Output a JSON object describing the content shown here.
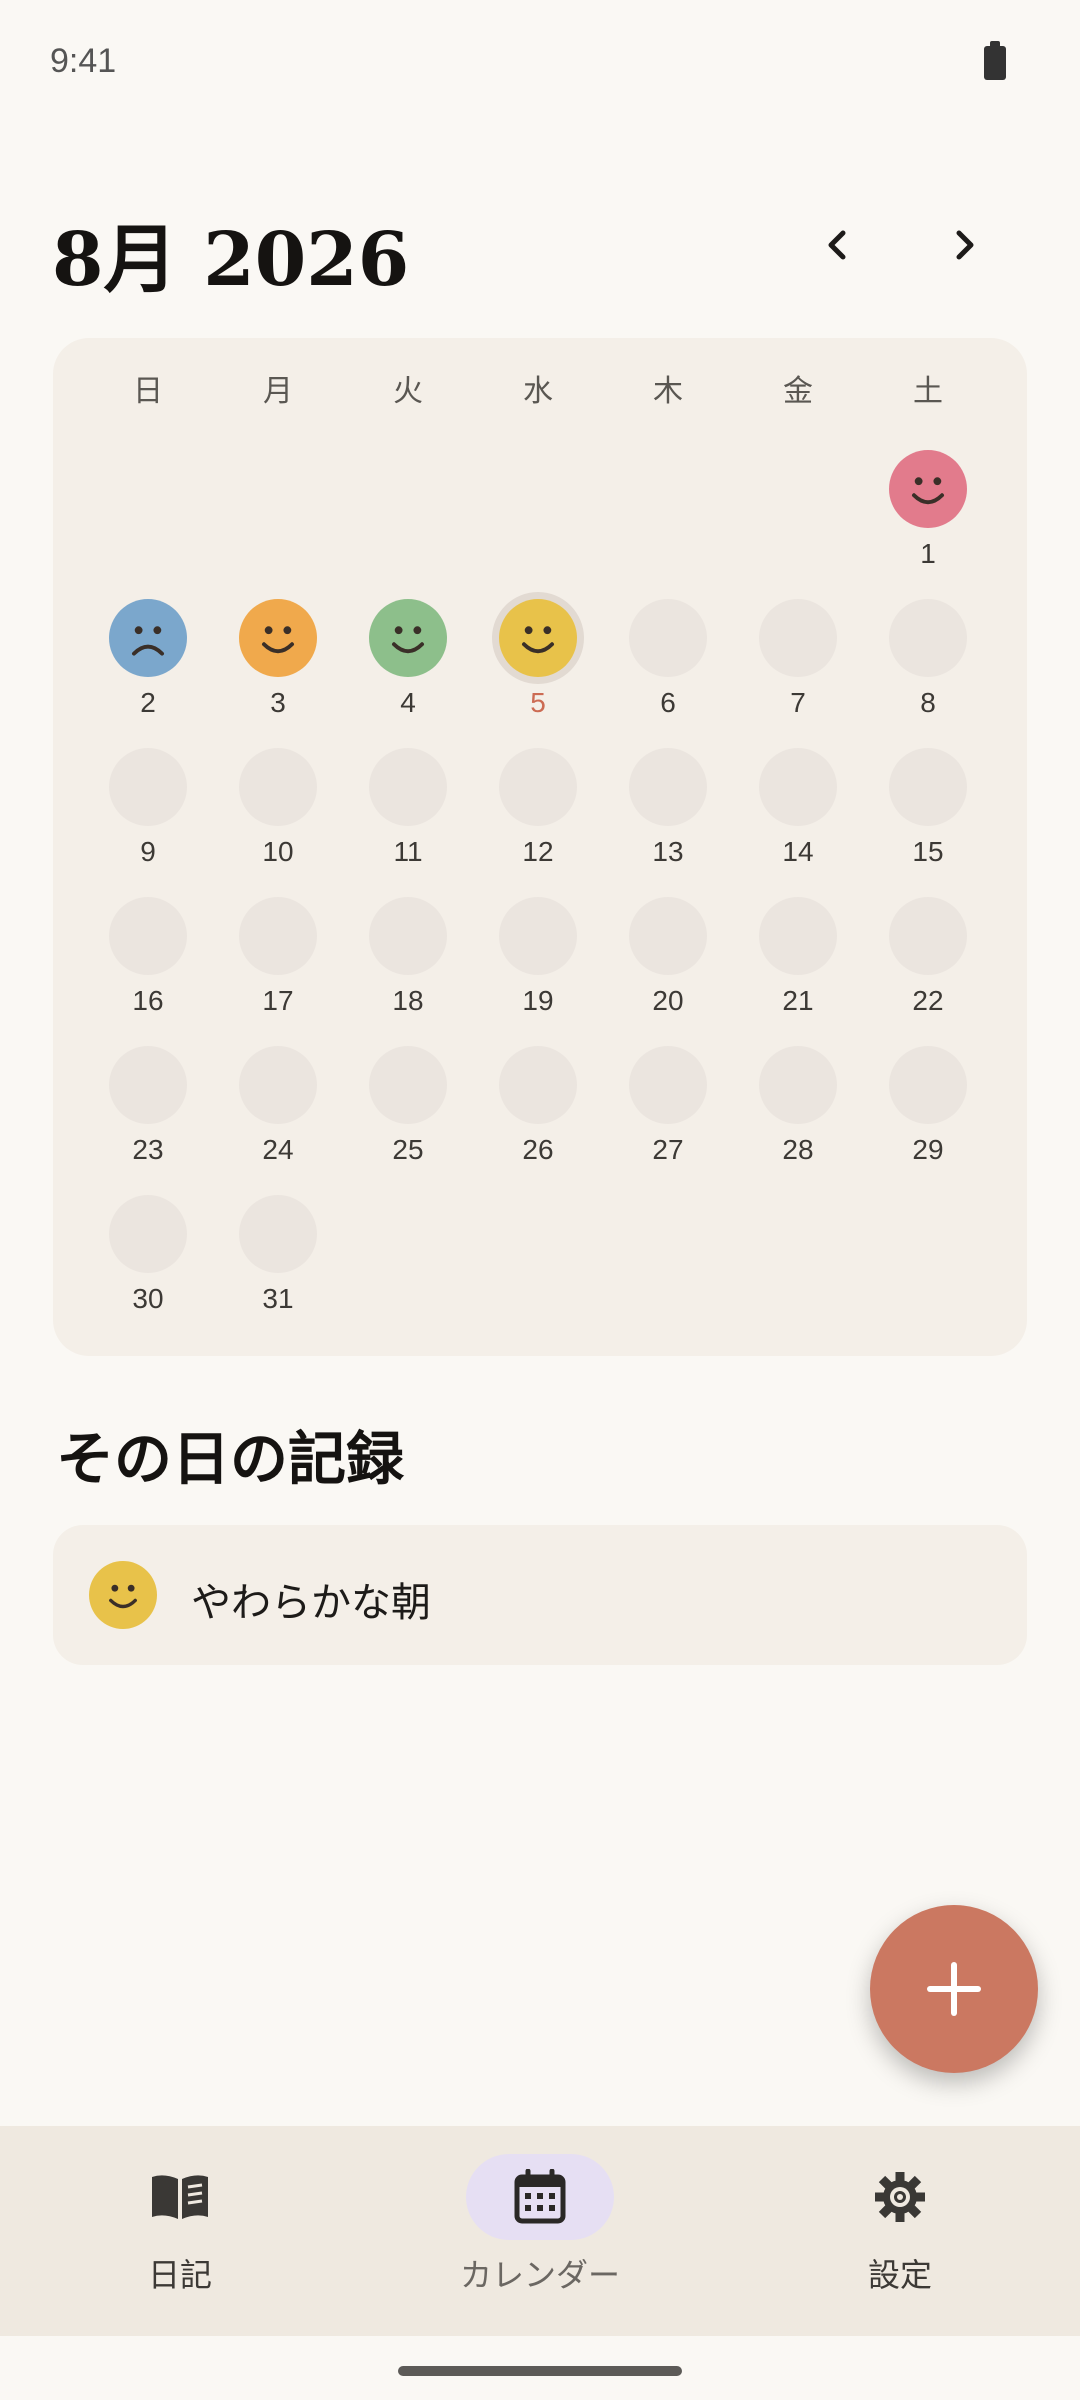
{
  "status_bar": {
    "time": "9:41"
  },
  "header": {
    "title": "8月 2026"
  },
  "calendar": {
    "weekdays": [
      "日",
      "月",
      "火",
      "水",
      "木",
      "金",
      "土"
    ],
    "first_weekday_index": 6,
    "days_in_month": 31,
    "today": 5,
    "moods": {
      "1": {
        "mood": "happy",
        "color": "#e27b8c"
      },
      "2": {
        "mood": "sad",
        "color": "#7ba7cc"
      },
      "3": {
        "mood": "happy",
        "color": "#f0a94c"
      },
      "4": {
        "mood": "happy",
        "color": "#8dbf8b"
      },
      "5": {
        "mood": "happy",
        "color": "#e8c24a"
      }
    }
  },
  "entries": {
    "section_title": "その日の記録",
    "items": [
      {
        "mood": "happy",
        "color": "#e8c24a",
        "text": "やわらかな朝"
      }
    ]
  },
  "fab": {
    "icon": "plus-icon"
  },
  "bottom_nav": {
    "items": [
      {
        "label": "日記",
        "icon": "book-icon",
        "active": false
      },
      {
        "label": "カレンダー",
        "icon": "calendar-icon",
        "active": true
      },
      {
        "label": "設定",
        "icon": "gear-icon",
        "active": false
      }
    ]
  },
  "colors": {
    "empty_day": "#ebe5df",
    "today_number": "#cc6b53",
    "fab": "#cb7861",
    "nav_active_pill": "#e6dff3"
  }
}
